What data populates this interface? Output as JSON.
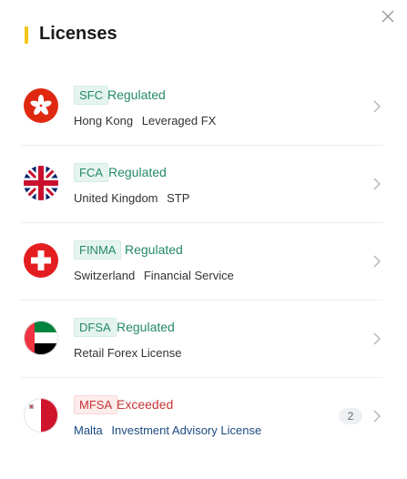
{
  "header": {
    "title": "Licenses",
    "accent_color": "#f5c518"
  },
  "close_icon": "close-icon",
  "licenses": [
    {
      "code": "SFC",
      "status": "Regulated",
      "status_type": "regulated",
      "region": "Hong Kong",
      "type": "Leveraged FX",
      "flag": "hong-kong-flag-icon"
    },
    {
      "code": "FCA",
      "status": "Regulated",
      "status_type": "regulated",
      "region": "United Kingdom",
      "type": "STP",
      "flag": "uk-flag-icon"
    },
    {
      "code": "FINMA",
      "status": "Regulated",
      "status_type": "regulated",
      "region": "Switzerland",
      "type": "Financial Service",
      "flag": "switzerland-flag-icon"
    },
    {
      "code": "DFSA",
      "status": "Regulated",
      "status_type": "regulated",
      "region": "",
      "type": "Retail Forex License",
      "flag": "uae-flag-icon"
    },
    {
      "code": "MFSA",
      "status": "Exceeded",
      "status_type": "exceeded",
      "region": "Malta",
      "type": "Investment Advisory License",
      "flag": "malta-flag-icon",
      "count": "2"
    }
  ],
  "colors": {
    "regulated": "#238a63",
    "exceeded": "#c63535",
    "link_blue": "#1d4b80"
  }
}
